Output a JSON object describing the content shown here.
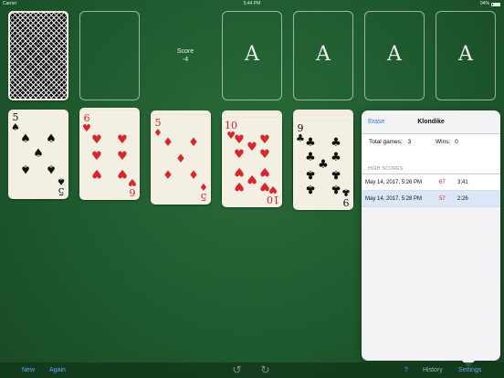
{
  "status_bar": {
    "carrier": "Carrier",
    "time": "5:44 PM",
    "battery": "94%"
  },
  "score": {
    "label": "Score",
    "value": "-4"
  },
  "foundations": [
    "A",
    "A",
    "A",
    "A"
  ],
  "tableau": [
    {
      "rank": "5",
      "suit": "♠",
      "color": "black"
    },
    {
      "rank": "6",
      "suit": "♥",
      "color": "red"
    },
    {
      "rank": "5",
      "suit": "♦",
      "color": "red"
    },
    {
      "rank": "10",
      "suit": "♥",
      "color": "red"
    },
    {
      "rank": "9",
      "suit": "♣",
      "color": "black"
    }
  ],
  "popover": {
    "erase_label": "Erase",
    "title": "Klondike",
    "total_games_label": "Total games:",
    "total_games": "3",
    "wins_label": "Wins:",
    "wins": "0",
    "high_scores_label": "HIGH SCORES",
    "rows": [
      {
        "date": "May 14, 2017, 5:26 PM",
        "score": "67",
        "time": "3:41"
      },
      {
        "date": "May 14, 2017, 5:28 PM",
        "score": "57",
        "time": "2:26"
      }
    ]
  },
  "toolbar": {
    "new_label": "New",
    "again_label": "Again",
    "help_label": "?",
    "history_label": "History",
    "settings_label": "Settings"
  },
  "colors": {
    "felt": "#1f5a2e",
    "accent": "#5aa7ff",
    "card_red": "#d8262a"
  }
}
